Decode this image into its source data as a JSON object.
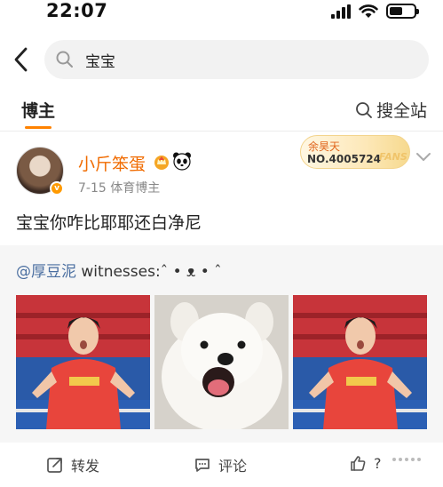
{
  "status_bar": {
    "time": "22:07"
  },
  "search": {
    "query": "宝宝"
  },
  "tabs": {
    "blogger": "博主",
    "search_all": "搜全站"
  },
  "post": {
    "author": "小斤笨蛋",
    "meta": "7-15  体育博主",
    "badges": [
      "crown-icon",
      "panda-icon"
    ],
    "fans_badge": {
      "name": "余昊天",
      "number": "NO.4005724",
      "word": "FANS"
    },
    "text": "宝宝你咋比耶耶还白净尼",
    "repost": {
      "author": "@厚豆泥",
      "body": " witnesses:ˆ • ᴥ • ˆ"
    }
  },
  "actions": {
    "repost": "转发",
    "comment": "评论",
    "like": "?"
  },
  "colors": {
    "accent": "#ff8200",
    "username": "#f06b00",
    "link": "#4a6ea0"
  }
}
